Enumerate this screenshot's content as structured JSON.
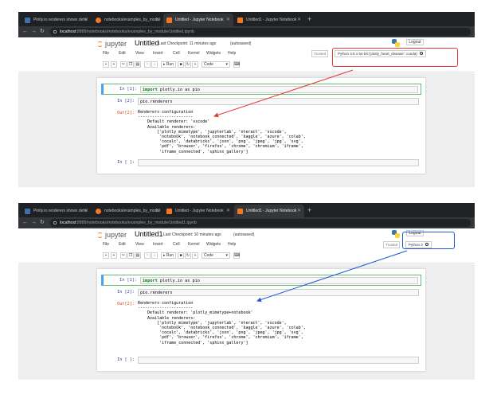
{
  "screens": [
    {
      "tabs": [
        {
          "label": "Plotly.io.renderers shows defa"
        },
        {
          "label": "notebooks/examples_by_modul"
        },
        {
          "label": "Untitled - Jupyter Notebook"
        },
        {
          "label": "Untitled1 - Jupyter Notebook"
        }
      ],
      "url_host": "localhost",
      "url_rest": ":8889/notebooks/notebooks/examples_by_module/Untitled.ipynb",
      "logo_text": "jupyter",
      "notebook_title": "Untitled",
      "checkpoint": "Last Checkpoint: 11 minutes ago",
      "autosaved": "(autosaved)",
      "logout_label": "Logout",
      "menu": [
        "File",
        "Edit",
        "View",
        "Insert",
        "Cell",
        "Kernel",
        "Widgets",
        "Help"
      ],
      "trusted_label": "Trusted",
      "kernel_label": "Python 3.8.1 64-bit ('plotly_heart_disease': conda)",
      "run_label": "Run",
      "cell_type": "Code",
      "cells": [
        {
          "prompt": "In [1]:",
          "code_kw": "import",
          "code_rest": " plotly.io as pio"
        },
        {
          "prompt": "In [2]:",
          "code": "pio.renderers"
        },
        {
          "prompt": "Out[2]:",
          "output": "Renderers configuration\n-----------------------\n    Default renderer: 'vscode'\n    Available renderers:\n        ['plotly_mimetype', 'jupyterlab', 'nteract', 'vscode',\n         'notebook', 'notebook_connected', 'kaggle', 'azure', 'colab',\n         'cocalc', 'databricks', 'json', 'png', 'jpeg', 'jpg', 'svg',\n         'pdf', 'browser', 'firefox', 'chrome', 'chromium', 'iframe',\n         'iframe_connected', 'sphinx_gallery']"
        },
        {
          "prompt": "In [ ]:",
          "code": ""
        }
      ],
      "annotation_color": "#e53935"
    },
    {
      "tabs": [
        {
          "label": "Plotly.io.renderers shows defa"
        },
        {
          "label": "notebooks/examples_by_modul"
        },
        {
          "label": "Untitled - Jupyter Notebook"
        },
        {
          "label": "Untitled1 - Jupyter Notebook"
        }
      ],
      "url_host": "localhost",
      "url_rest": ":8889/notebooks/notebooks/examples_by_module/Untitled1.ipynb",
      "logo_text": "jupyter",
      "notebook_title": "Untitled1",
      "checkpoint": "Last Checkpoint: 10 minutes ago",
      "autosaved": "(autosaved)",
      "logout_label": "Logout",
      "menu": [
        "File",
        "Edit",
        "View",
        "Insert",
        "Cell",
        "Kernel",
        "Widgets",
        "Help"
      ],
      "trusted_label": "Trusted",
      "kernel_label": "Python 3",
      "run_label": "Run",
      "cell_type": "Code",
      "cells": [
        {
          "prompt": "In [1]:",
          "code_kw": "import",
          "code_rest": " plotly.io as pio"
        },
        {
          "prompt": "In [2]:",
          "code": "pio.renderers"
        },
        {
          "prompt": "Out[2]:",
          "output": "Renderers configuration\n-----------------------\n    Default renderer: 'plotly_mimetype+notebook'\n    Available renderers:\n        ['plotly_mimetype', 'jupyterlab', 'nteract', 'vscode',\n         'notebook', 'notebook_connected', 'kaggle', 'azure', 'colab',\n         'cocalc', 'databricks', 'json', 'png', 'jpeg', 'jpg', 'svg',\n         'pdf', 'browser', 'firefox', 'chrome', 'chromium', 'iframe',\n         'iframe_connected', 'sphinx_gallery']"
        },
        {
          "prompt": "In [ ]:",
          "code": ""
        }
      ],
      "annotation_color": "#1e5ad8"
    }
  ]
}
